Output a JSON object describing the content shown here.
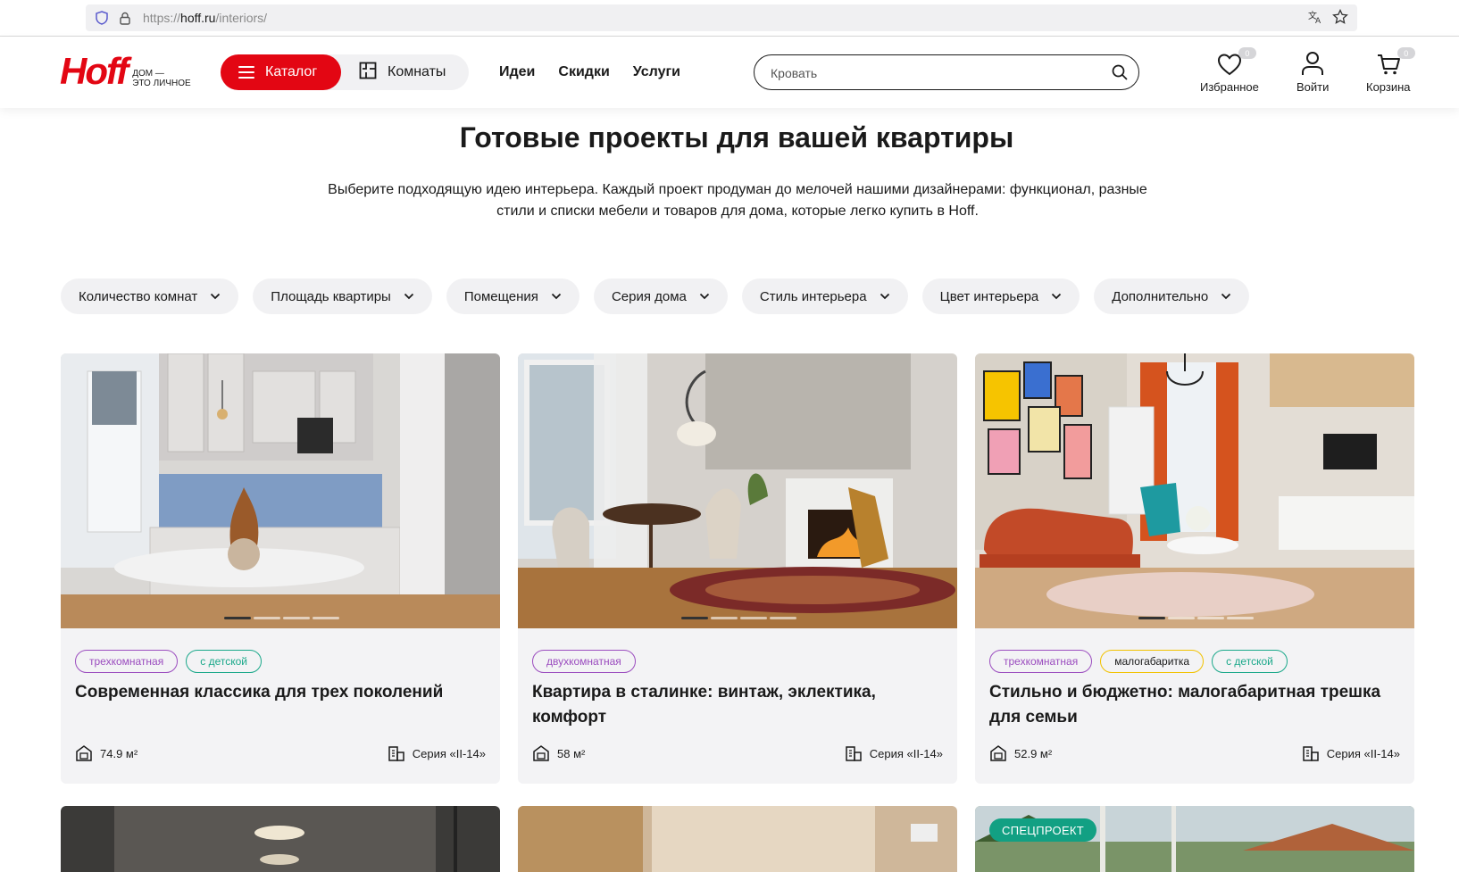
{
  "browser": {
    "url_prefix": "https://",
    "url_host": "hoff.ru",
    "url_path": "/interiors/"
  },
  "header": {
    "logo_word": "Hoff",
    "logo_tag_line1": "дом —",
    "logo_tag_line2": "это личное",
    "catalog_label": "Каталог",
    "rooms_label": "Комнаты",
    "nav": [
      "Идеи",
      "Скидки",
      "Услуги"
    ],
    "search_placeholder": "Кровать",
    "favorites_label": "Избранное",
    "favorites_count": "0",
    "login_label": "Войти",
    "cart_label": "Корзина",
    "cart_count": "0"
  },
  "main": {
    "title": "Готовые проекты для вашей квартиры",
    "intro_line1": "Выберите подходящую идею интерьера. Каждый проект продуман до мелочей нашими дизайнерами: функционал, разные",
    "intro_line2": "стили и списки мебели и товаров для дома, которые легко купить в Hoff."
  },
  "filters": [
    "Количество комнат",
    "Площадь квартиры",
    "Помещения",
    "Серия дома",
    "Стиль интерьера",
    "Цвет интерьера",
    "Дополнительно"
  ],
  "cards": [
    {
      "tags": [
        {
          "label": "трехкомнатная",
          "style": "purple"
        },
        {
          "label": "с детской",
          "style": "teal"
        }
      ],
      "title": "Современная классика для трех поколений",
      "area": "74.9 м²",
      "series": "Серия «II-14»"
    },
    {
      "tags": [
        {
          "label": "двухкомнатная",
          "style": "purple"
        }
      ],
      "title": "Квартира в сталинке: винтаж, эклектика, комфорт",
      "area": "58 м²",
      "series": "Серия «II-14»"
    },
    {
      "tags": [
        {
          "label": "трехкомнатная",
          "style": "purple"
        },
        {
          "label": "малогабаритка",
          "style": "yellow"
        },
        {
          "label": "с детской",
          "style": "teal"
        }
      ],
      "title": "Стильно и бюджетно: малогабаритная трешка для семьи",
      "area": "52.9 м²",
      "series": "Серия «II-14»"
    }
  ],
  "special_badge": "СПЕЦПРОЕКТ",
  "colors": {
    "brand_red": "#e30613",
    "tag_purple": "#9b4dbf",
    "tag_teal": "#1aa88a",
    "tag_yellow": "#f2c200",
    "special_green": "#12a083"
  }
}
